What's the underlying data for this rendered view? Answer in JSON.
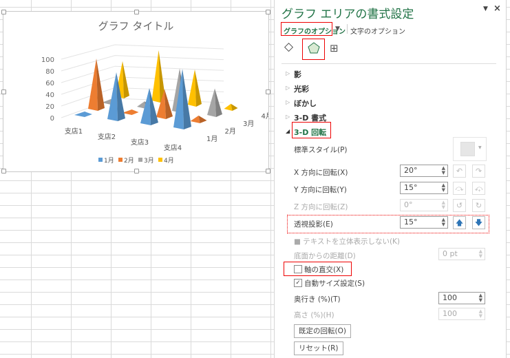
{
  "chart": {
    "title": "グラフ タイトル"
  },
  "chart_data": {
    "type": "bar",
    "subtype": "3d-pyramid",
    "title": "グラフ タイトル",
    "categories": [
      "支店1",
      "支店2",
      "支店3",
      "支店4"
    ],
    "series": [
      {
        "name": "1月",
        "color": "#5b9bd5",
        "values": [
          0,
          80,
          60,
          100
        ]
      },
      {
        "name": "2月",
        "color": "#ed7d31",
        "values": [
          90,
          5,
          50,
          10
        ]
      },
      {
        "name": "3月",
        "color": "#a5a5a5",
        "values": [
          5,
          10,
          80,
          50
        ]
      },
      {
        "name": "4月",
        "color": "#ffc000",
        "values": [
          70,
          100,
          70,
          10
        ]
      }
    ],
    "yticks": [
      0,
      20,
      40,
      60,
      80,
      100
    ],
    "ylim": [
      0,
      100
    ],
    "legend": "bottom"
  },
  "panel": {
    "title": "グラフ エリアの書式設定",
    "tab_chart": "グラフのオプション",
    "tab_text": "文字のオプション",
    "sections": [
      "影",
      "光彩",
      "ぼかし",
      "3-D 書式",
      "3-D 回転"
    ],
    "preset_label": "標準スタイル(P)",
    "x_label": "X 方向に回転(X)",
    "x_value": "20°",
    "y_label": "Y 方向に回転(Y)",
    "y_value": "15°",
    "z_label": "Z 方向に回転(Z)",
    "z_value": "0°",
    "persp_label": "透視投影(E)",
    "persp_value": "15°",
    "keep_text_flat": "テキストを立体表示しない(K)",
    "dist_label": "底面からの距離(D)",
    "dist_value": "0 pt",
    "right_angle": "軸の直交(X)",
    "right_angle_checked": false,
    "autoscale": "自動サイズ設定(S)",
    "autoscale_checked": true,
    "depth_label": "奥行き (%)(T)",
    "depth_value": "100",
    "height_label": "高さ (%)(H)",
    "height_value": "100",
    "default_rotation": "既定の回転(O)",
    "reset": "リセット(R)"
  }
}
